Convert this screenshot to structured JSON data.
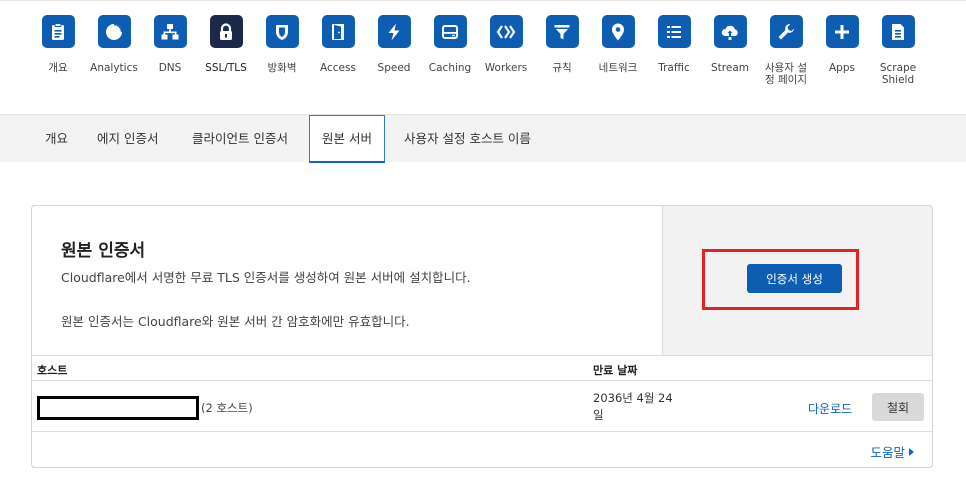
{
  "apps": [
    {
      "label": "개요",
      "icon": "clipboard-icon"
    },
    {
      "label": "Analytics",
      "icon": "pie-chart-icon"
    },
    {
      "label": "DNS",
      "icon": "network-icon"
    },
    {
      "label": "SSL/TLS",
      "icon": "lock-icon",
      "active": true
    },
    {
      "label": "방화벽",
      "icon": "shield-icon"
    },
    {
      "label": "Access",
      "icon": "door-icon"
    },
    {
      "label": "Speed",
      "icon": "lightning-icon"
    },
    {
      "label": "Caching",
      "icon": "server-drive-icon"
    },
    {
      "label": "Workers",
      "icon": "workers-chevrons-icon"
    },
    {
      "label": "규칙",
      "icon": "filter-funnel-icon"
    },
    {
      "label": "네트워크",
      "icon": "location-pin-icon"
    },
    {
      "label": "Traffic",
      "icon": "list-icon"
    },
    {
      "label": "Stream",
      "icon": "cloud-upload-icon"
    },
    {
      "label": "사용자 설\n정 페이지",
      "icon": "wrench-icon"
    },
    {
      "label": "Apps",
      "icon": "plus-icon"
    },
    {
      "label": "Scrape\nShield",
      "icon": "document-icon"
    }
  ],
  "subtabs": [
    {
      "label": "개요"
    },
    {
      "label": "에지 인증서"
    },
    {
      "label": "클라이언트 인증서"
    },
    {
      "label": "원본 서버",
      "active": true
    },
    {
      "label": "사용자 설정 호스트 이름"
    }
  ],
  "card": {
    "title": "원본 인증서",
    "description1": "Cloudflare에서 서명한 무료 TLS 인증서를 생성하여 원본 서버에 설치합니다.",
    "description2": "원본 인증서는 Cloudflare와 원본 서버 간 암호화에만 유효합니다.",
    "create_button": "인증서 생성",
    "table": {
      "col_host": "호스트",
      "col_expiry": "만료 날짜",
      "row": {
        "host_count": "(2 호스트)",
        "expiry": "2036년 4월 24일",
        "download": "다운로드",
        "revoke": "철회"
      }
    },
    "help_link": "도움말"
  },
  "colors": {
    "brand_blue": "#0d5db3",
    "active_tile": "#1b2a4a",
    "highlight_red": "#e32227",
    "link_blue": "#1064c8"
  }
}
